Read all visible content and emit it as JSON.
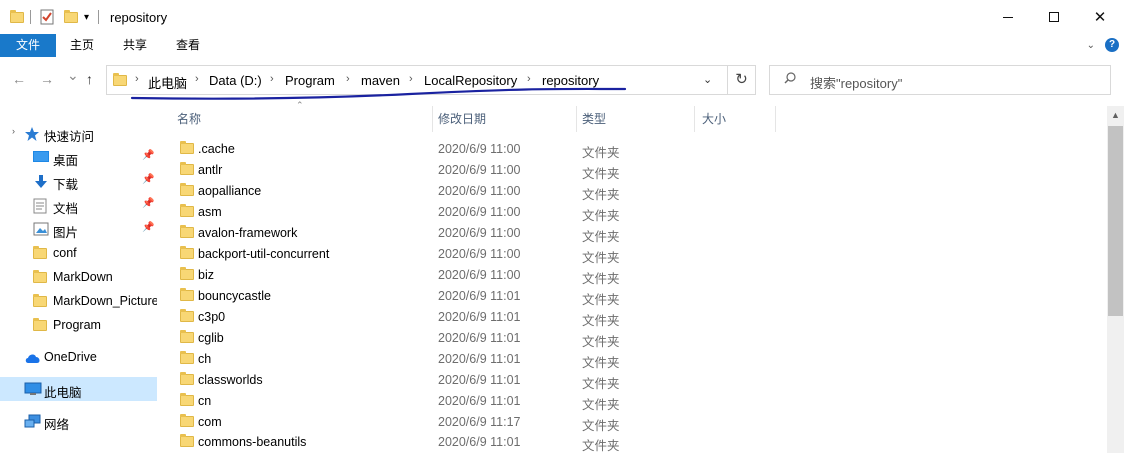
{
  "window": {
    "title": "repository",
    "minimize_icon": "minimize-icon",
    "maximize_icon": "maximize-icon",
    "close_label": "✕"
  },
  "ribbon": {
    "tabs": [
      "文件",
      "主页",
      "共享",
      "查看"
    ],
    "file_tab_color": "#1979ca"
  },
  "nav": {
    "back_label": "←",
    "forward_label": "→",
    "recent_label": "⌄",
    "up_label": "↑"
  },
  "address": {
    "breadcrumbs": [
      "此电脑",
      "Data (D:)",
      "Program",
      "maven",
      "LocalRepository",
      "repository"
    ],
    "separator": "›",
    "dropdown_label": "⌄",
    "refresh_label": "↻"
  },
  "search": {
    "placeholder": "搜索\"repository\""
  },
  "annotation": {
    "color": "#1a22a0"
  },
  "sidebar": {
    "items": [
      {
        "label": "快速访问",
        "icon": "star-icon"
      },
      {
        "label": "桌面",
        "icon": "desktop-icon",
        "pinned": true
      },
      {
        "label": "下载",
        "icon": "download-icon",
        "pinned": true
      },
      {
        "label": "文档",
        "icon": "document-icon",
        "pinned": true
      },
      {
        "label": "图片",
        "icon": "picture-icon",
        "pinned": true
      },
      {
        "label": "conf",
        "icon": "folder-icon"
      },
      {
        "label": "MarkDown",
        "icon": "folder-icon"
      },
      {
        "label": "MarkDown_Picture",
        "icon": "folder-icon"
      },
      {
        "label": "Program",
        "icon": "folder-icon"
      },
      {
        "label": "OneDrive",
        "icon": "cloud-icon"
      },
      {
        "label": "此电脑",
        "icon": "computer-icon",
        "selected": true
      },
      {
        "label": "网络",
        "icon": "network-icon"
      }
    ],
    "pin_glyph": "📌"
  },
  "columns": {
    "name": "名称",
    "date": "修改日期",
    "type": "类型",
    "size": "大小"
  },
  "files": [
    {
      "name": ".cache",
      "date": "2020/6/9 11:00",
      "type": "文件夹"
    },
    {
      "name": "antlr",
      "date": "2020/6/9 11:00",
      "type": "文件夹"
    },
    {
      "name": "aopalliance",
      "date": "2020/6/9 11:00",
      "type": "文件夹"
    },
    {
      "name": "asm",
      "date": "2020/6/9 11:00",
      "type": "文件夹"
    },
    {
      "name": "avalon-framework",
      "date": "2020/6/9 11:00",
      "type": "文件夹"
    },
    {
      "name": "backport-util-concurrent",
      "date": "2020/6/9 11:00",
      "type": "文件夹"
    },
    {
      "name": "biz",
      "date": "2020/6/9 11:00",
      "type": "文件夹"
    },
    {
      "name": "bouncycastle",
      "date": "2020/6/9 11:01",
      "type": "文件夹"
    },
    {
      "name": "c3p0",
      "date": "2020/6/9 11:01",
      "type": "文件夹"
    },
    {
      "name": "cglib",
      "date": "2020/6/9 11:01",
      "type": "文件夹"
    },
    {
      "name": "ch",
      "date": "2020/6/9 11:01",
      "type": "文件夹"
    },
    {
      "name": "classworlds",
      "date": "2020/6/9 11:01",
      "type": "文件夹"
    },
    {
      "name": "cn",
      "date": "2020/6/9 11:01",
      "type": "文件夹"
    },
    {
      "name": "com",
      "date": "2020/6/9 11:17",
      "type": "文件夹"
    },
    {
      "name": "commons-beanutils",
      "date": "2020/6/9 11:01",
      "type": "文件夹"
    }
  ]
}
